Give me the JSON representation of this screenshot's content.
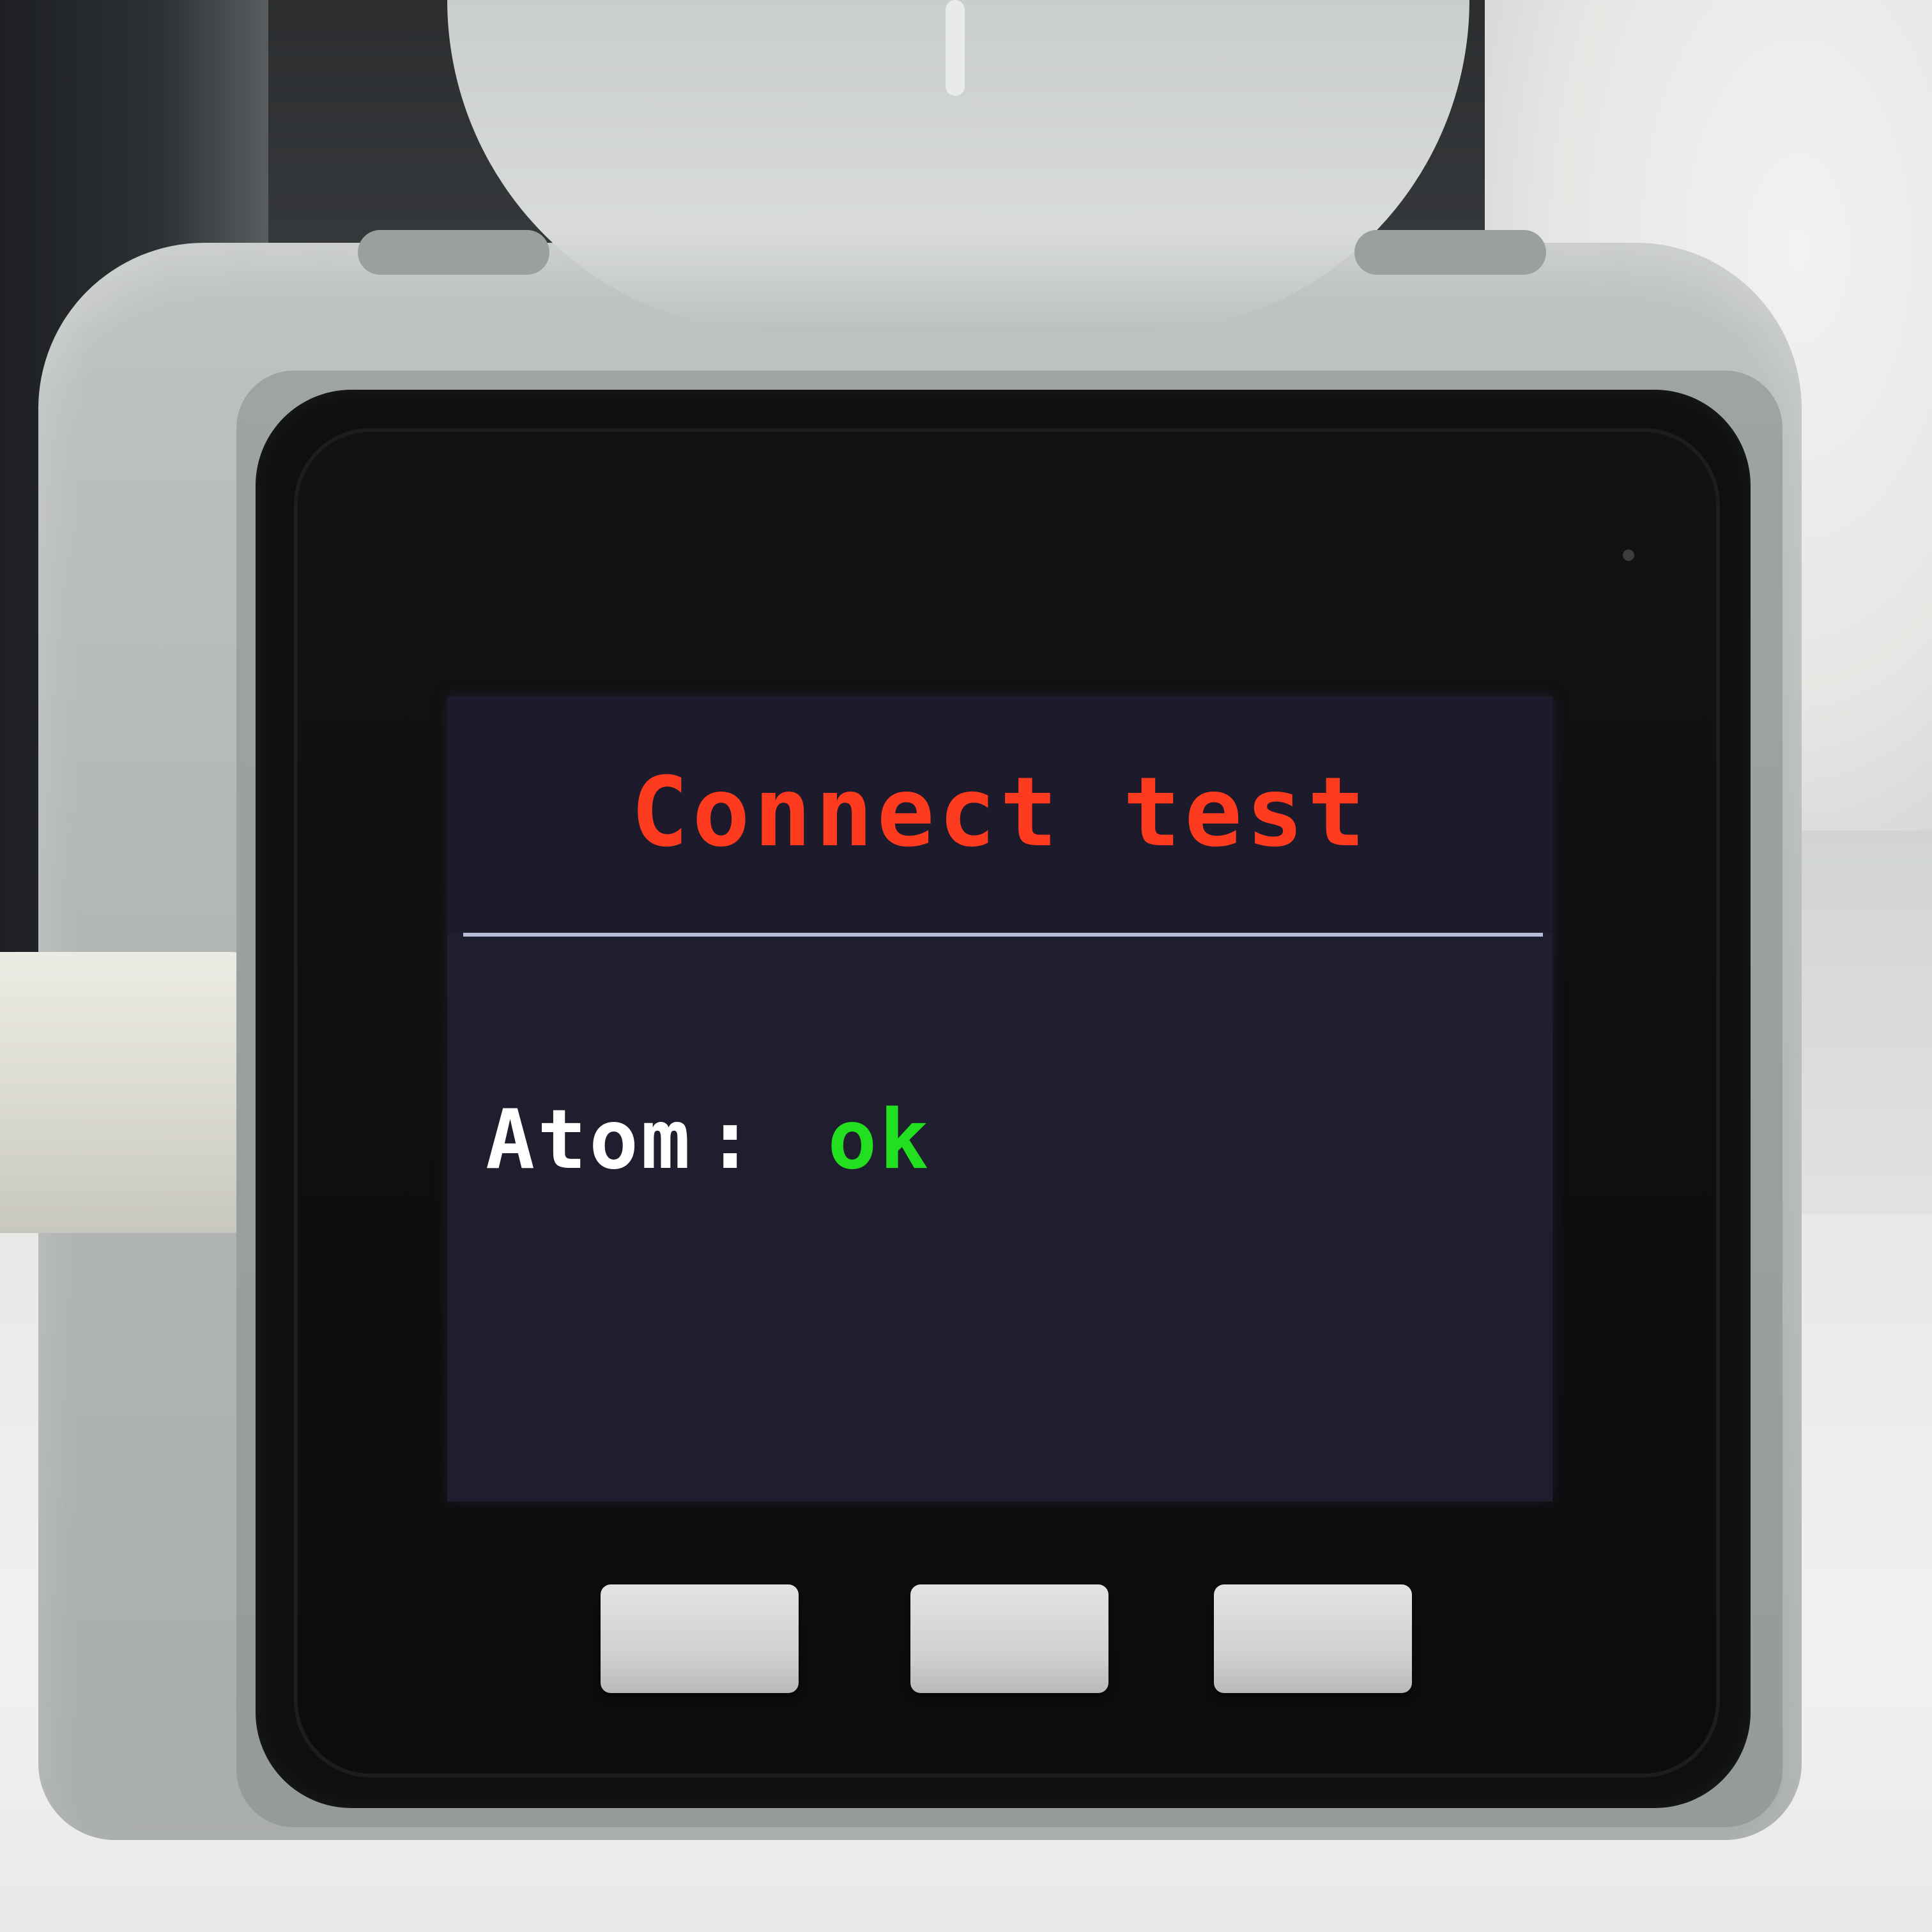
{
  "screen": {
    "title": "Connect test",
    "status_rows": [
      {
        "label": "Atom",
        "separator": ":",
        "value": "ok"
      }
    ]
  },
  "colors": {
    "screen_background": "#1f1e2e",
    "title_text": "#ff3b1f",
    "divider": "#b9bcd6",
    "label_text": "#ffffff",
    "ok_text": "#22e01f",
    "bezel": "#0e0f10",
    "buttons": "#d9dad8"
  },
  "hardware_buttons": [
    {
      "name": "button-a"
    },
    {
      "name": "button-b"
    },
    {
      "name": "button-c"
    }
  ]
}
